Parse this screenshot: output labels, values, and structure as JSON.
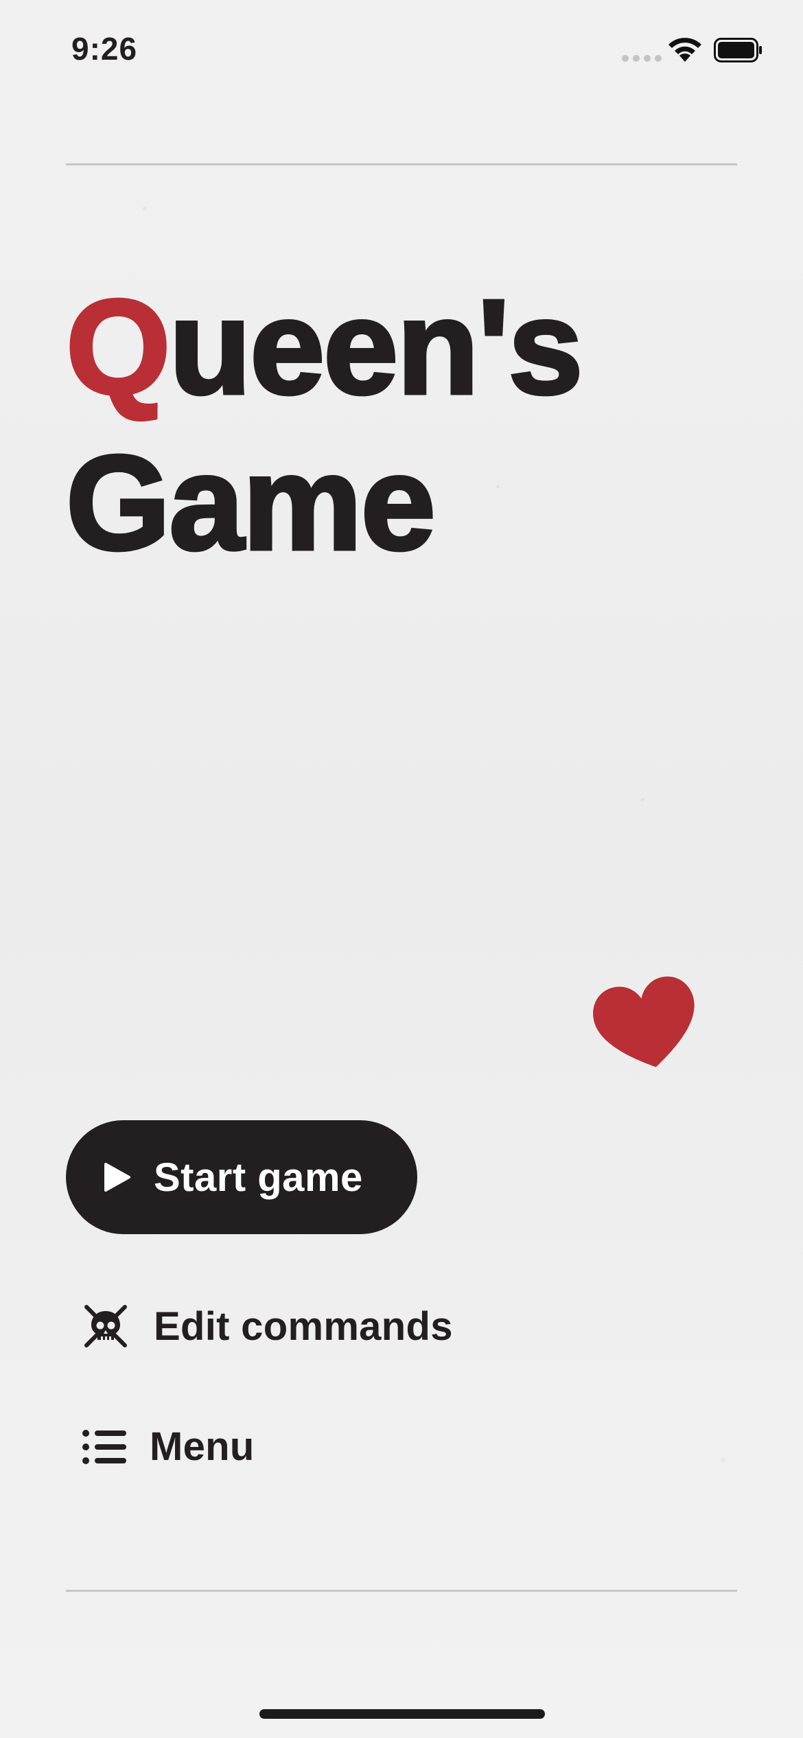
{
  "status_bar": {
    "time": "9:26",
    "signal_icon": "cellular-signal-icon",
    "wifi_icon": "wifi-icon",
    "battery_icon": "battery-icon"
  },
  "title": {
    "accent_letter": "Q",
    "line1_rest": "ueen's",
    "line2": "Game",
    "accent_color": "#b92f35",
    "text_color": "#231f20"
  },
  "decoration": {
    "heart_icon": "heart-icon",
    "heart_color": "#b92f35"
  },
  "actions": {
    "start": {
      "label": "Start game",
      "icon": "play-icon",
      "background_color": "#231f20"
    },
    "edit": {
      "label": "Edit commands",
      "icon": "skull-crossbones-icon"
    },
    "menu": {
      "label": "Menu",
      "icon": "list-icon"
    }
  }
}
